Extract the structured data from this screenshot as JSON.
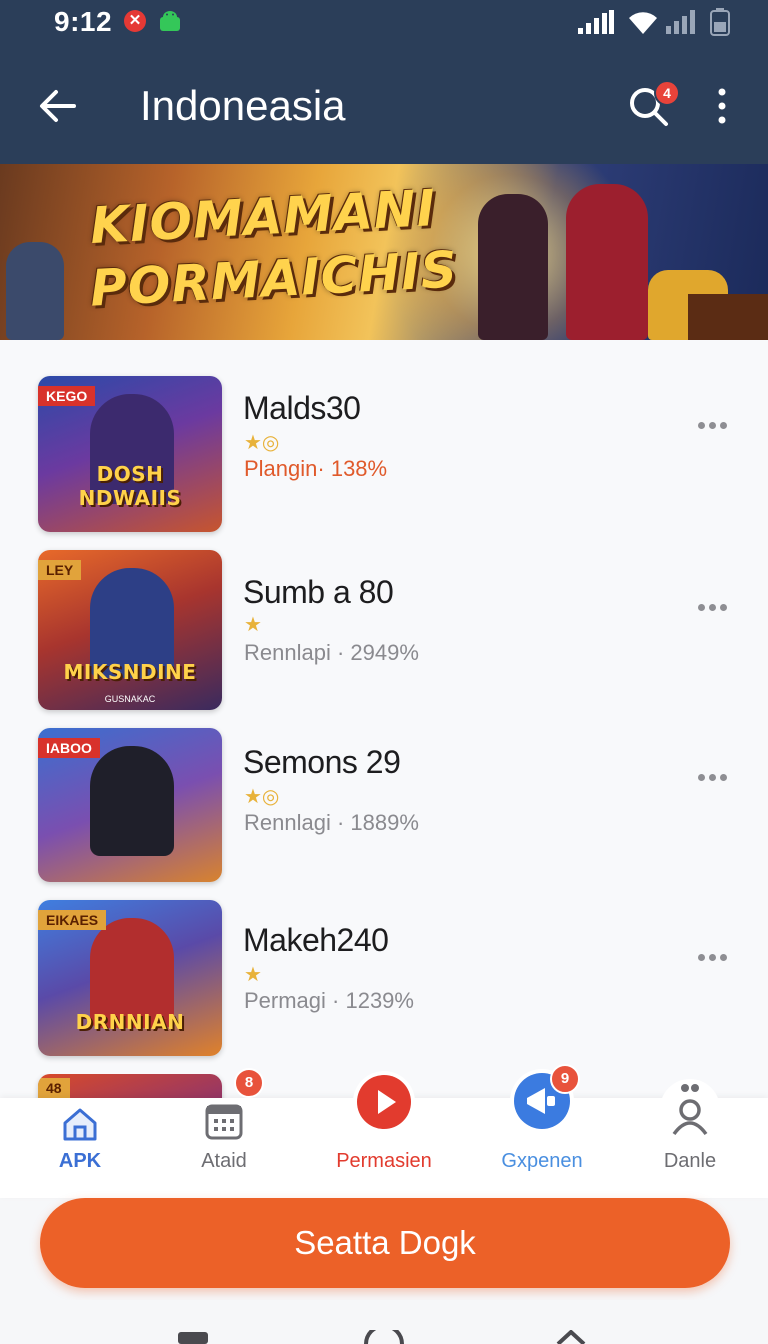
{
  "status": {
    "time": "9:12"
  },
  "header": {
    "title": "Indoneasia",
    "search_badge": "4"
  },
  "banner": {
    "line1": "KIOMAMANI",
    "line2": "PORMAICHIS"
  },
  "colors": {
    "header_bg": "#2b3e59",
    "accent": "#ec6128",
    "rating_hot": "#e05a2b",
    "nav_active": "#3b6fd4"
  },
  "games": [
    {
      "tag": "KEGO",
      "logo": "DOSH NDWAIIS",
      "logo_sub": "",
      "name": "Malds30",
      "stars": "★◎",
      "meta": "Plangin· 138%",
      "hot": true
    },
    {
      "tag": "LEY",
      "logo": "MIKSNDINE",
      "logo_sub": "GUSNAKAC",
      "name": "Sumb a 80",
      "stars": "★",
      "meta": "Rennlapi · 2949%",
      "hot": false
    },
    {
      "tag": "IABOO",
      "logo": "",
      "logo_sub": "",
      "name": "Semons 29",
      "stars": "★◎",
      "meta": "Rennlagi · 1889%",
      "hot": false
    },
    {
      "tag": "EIKAES",
      "logo": "DRNNIAN",
      "logo_sub": "",
      "name": "Makeh240",
      "stars": "★",
      "meta": "Permagi · 1239%",
      "hot": false
    }
  ],
  "partial_tag": "48",
  "nav": [
    {
      "label": "APK",
      "icon": "home-icon",
      "badge": ""
    },
    {
      "label": "Ataid",
      "icon": "calendar-icon",
      "badge": "8"
    },
    {
      "label": "Permasien",
      "icon": "play-icon",
      "badge": ""
    },
    {
      "label": "Gxpenen",
      "icon": "megaphone-icon",
      "badge": "9"
    },
    {
      "label": "Danle",
      "icon": "person-icon",
      "badge": ""
    }
  ],
  "cta": {
    "label": "Seatta Dogk"
  }
}
